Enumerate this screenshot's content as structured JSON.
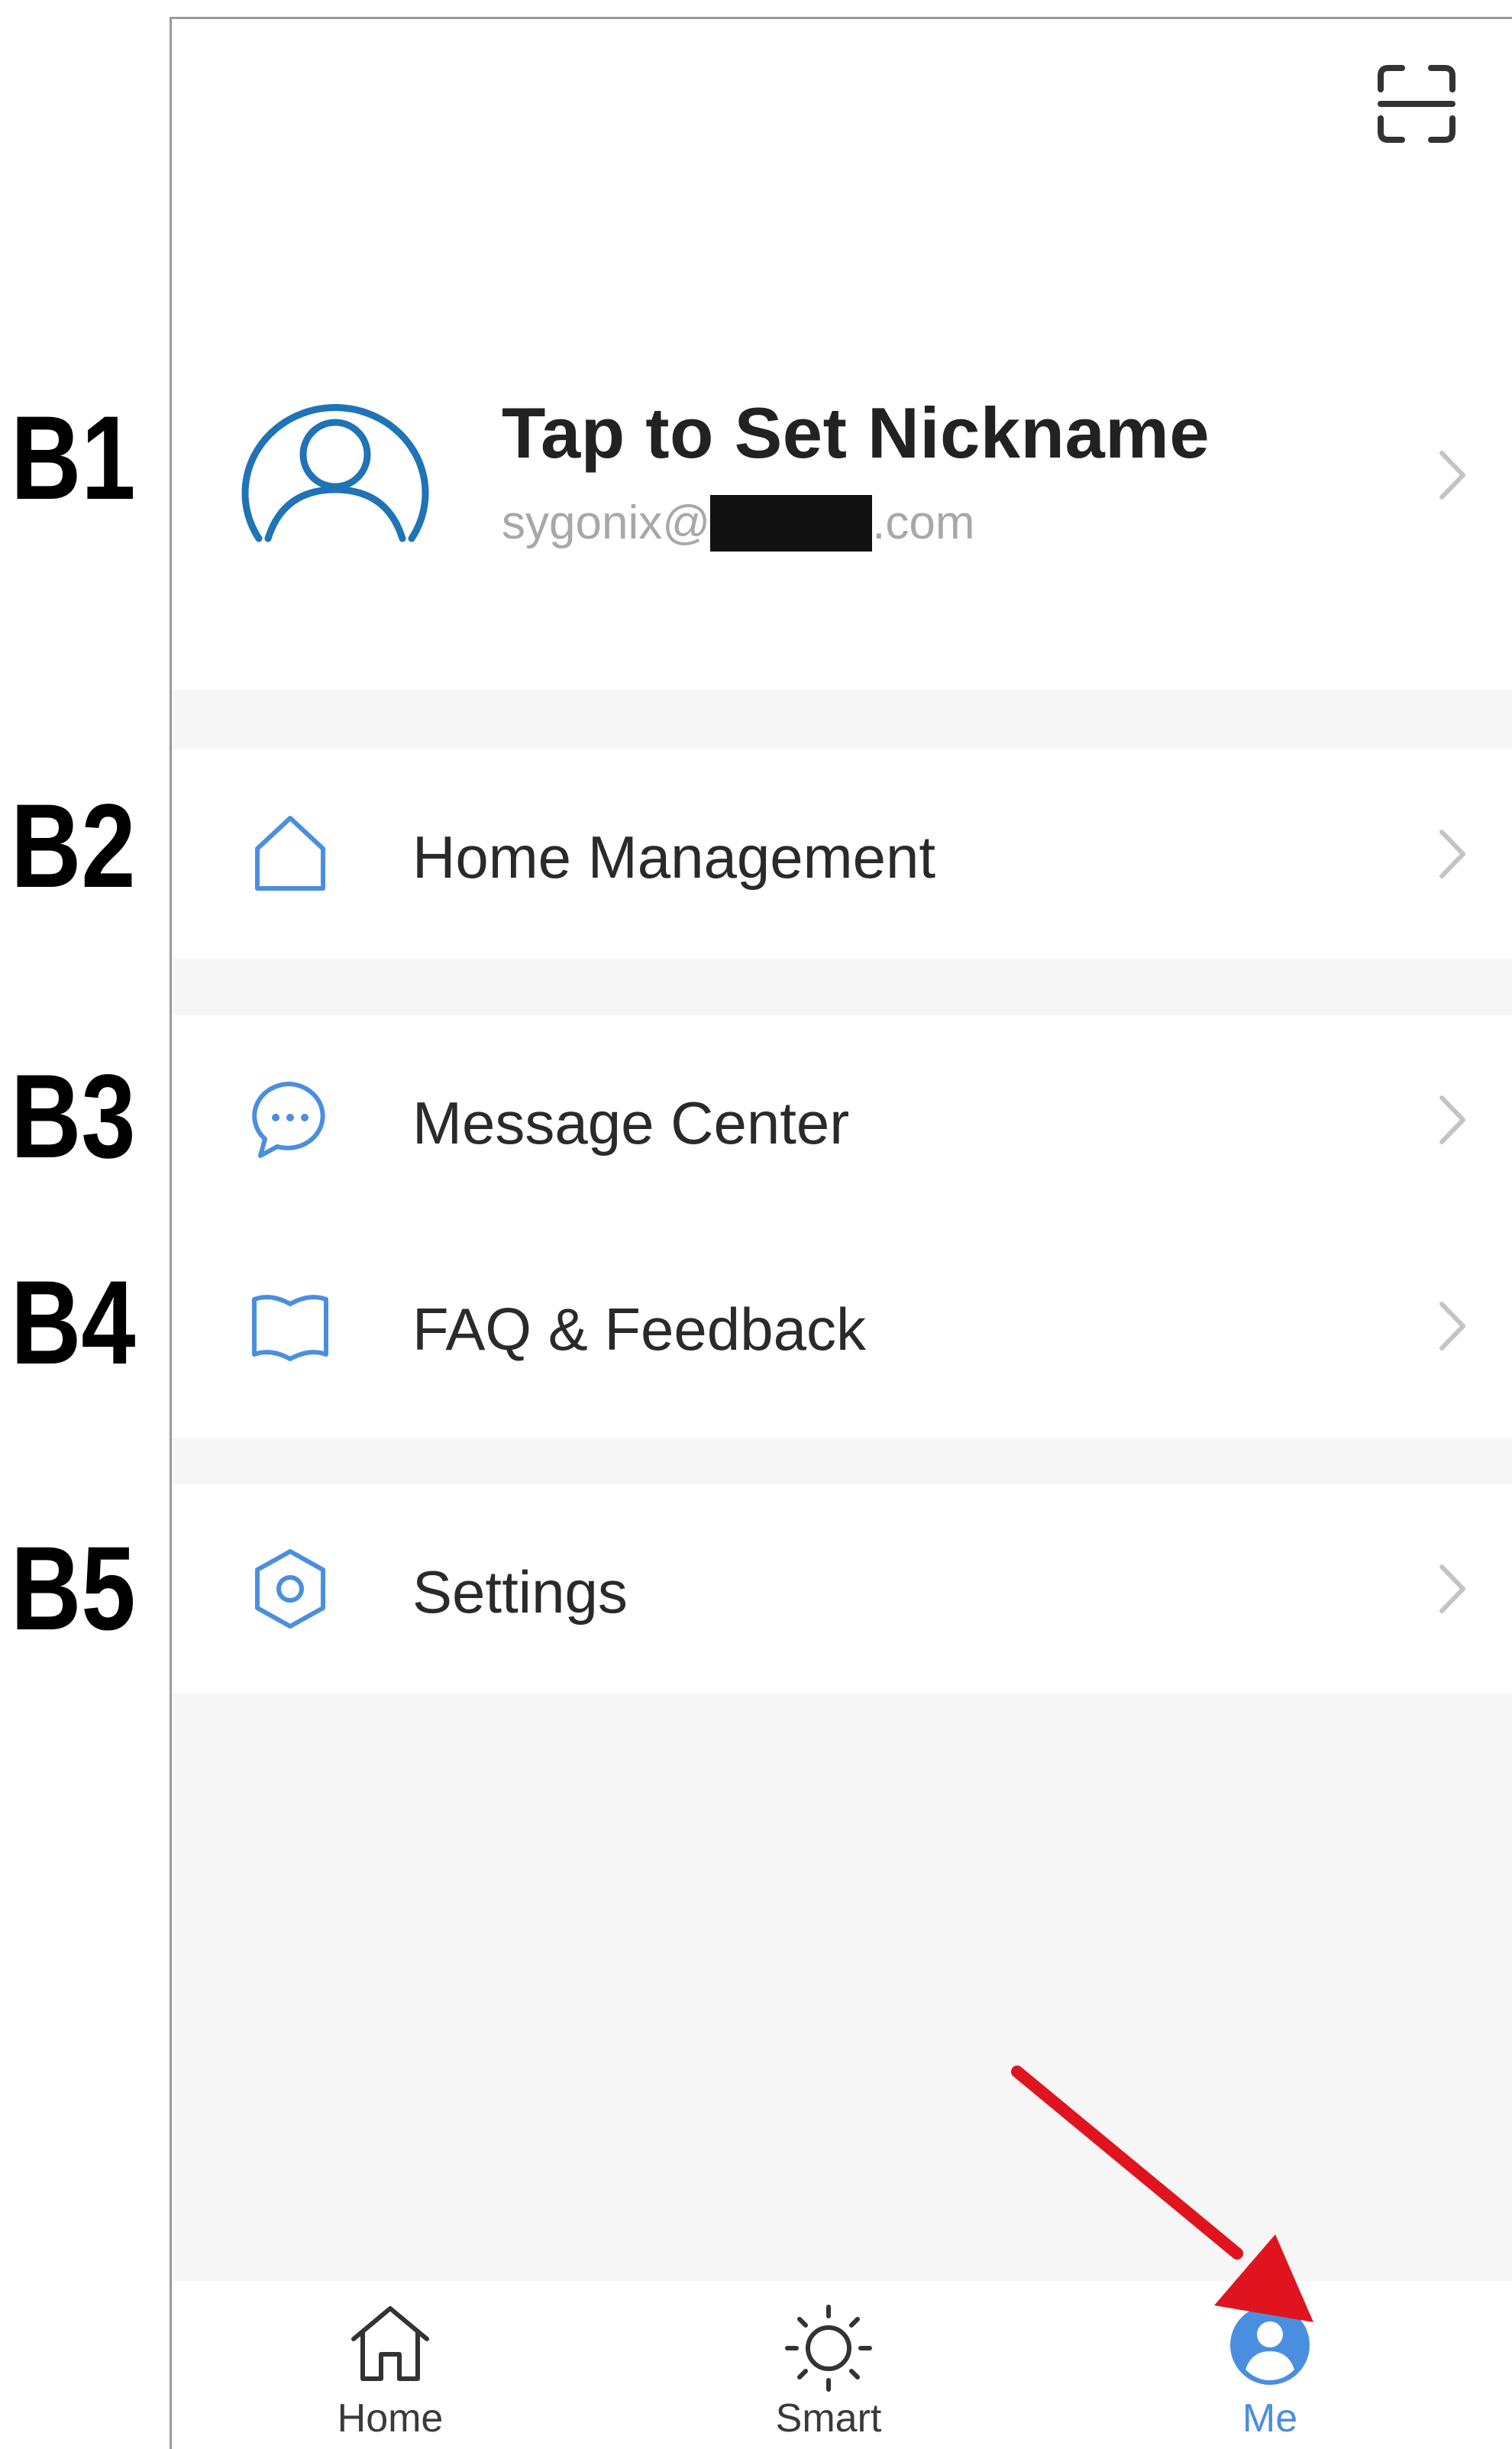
{
  "annotations": {
    "b1": "B1",
    "b2": "B2",
    "b3": "B3",
    "b4": "B4",
    "b5": "B5"
  },
  "profile": {
    "nickname": "Tap to Set Nickname",
    "email_prefix": "sygonix@",
    "email_suffix": ".com",
    "avatar_icon": "user-avatar-icon"
  },
  "header": {
    "scan_icon": "scan-icon"
  },
  "menu": {
    "home_management": "Home Management",
    "message_center": "Message Center",
    "faq_feedback": "FAQ & Feedback",
    "settings": "Settings"
  },
  "tabs": [
    {
      "label": "Home",
      "icon": "home-icon"
    },
    {
      "label": "Smart",
      "icon": "sun-icon"
    },
    {
      "label": "Me",
      "icon": "person-icon"
    }
  ],
  "colors": {
    "accent": "#4a8ee0",
    "avatar_ring": "#1f73b7",
    "annotation_arrow": "#e0141e",
    "background": "#f6f6f6"
  }
}
